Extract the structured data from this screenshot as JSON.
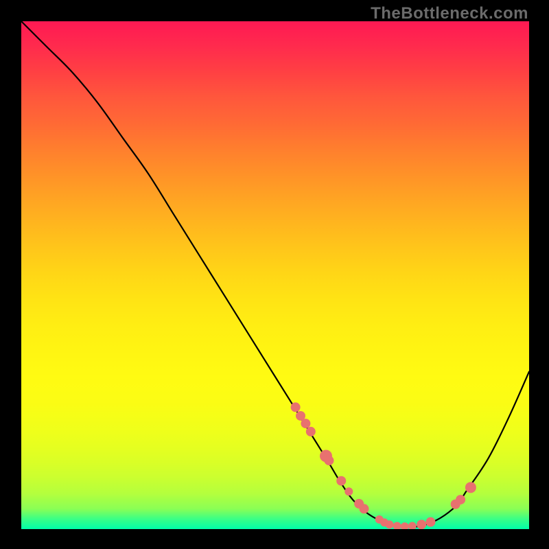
{
  "watermark": "TheBottleneck.com",
  "colors": {
    "dot": "#e8716f",
    "curve": "#000000",
    "background": "#000000"
  },
  "chart_data": {
    "type": "line",
    "title": "",
    "xlabel": "",
    "ylabel": "",
    "xlim": [
      0,
      100
    ],
    "ylim": [
      0,
      100
    ],
    "grid": false,
    "curve": {
      "x": [
        0,
        5,
        10,
        15,
        20,
        25,
        30,
        35,
        40,
        45,
        50,
        55,
        60,
        63,
        66,
        70,
        75,
        80,
        85,
        88,
        92,
        96,
        100
      ],
      "y": [
        100,
        95,
        90,
        84,
        77,
        70,
        62,
        54,
        46,
        38,
        30,
        22,
        14,
        9,
        5,
        2,
        0.5,
        1,
        4,
        8,
        14,
        22,
        31
      ]
    },
    "series": [
      {
        "name": "markers",
        "type": "scatter",
        "x": [
          54,
          55,
          56,
          57,
          60,
          60.6,
          63,
          64.5,
          66.5,
          67.5,
          70.5,
          71.5,
          72.5,
          74,
          75.5,
          77,
          78.8,
          80.6,
          85.5,
          86.5,
          88.5
        ],
        "y": [
          24,
          22.3,
          20.8,
          19.2,
          14.4,
          13.5,
          9.5,
          7.4,
          5,
          4,
          1.9,
          1.3,
          0.9,
          0.6,
          0.5,
          0.6,
          0.9,
          1.4,
          4.9,
          5.8,
          8.2
        ],
        "r": [
          7,
          7,
          7,
          7,
          9,
          7,
          7,
          6,
          7,
          7,
          6,
          6,
          6,
          6,
          6,
          6,
          7,
          7,
          7,
          7,
          8
        ]
      }
    ]
  }
}
